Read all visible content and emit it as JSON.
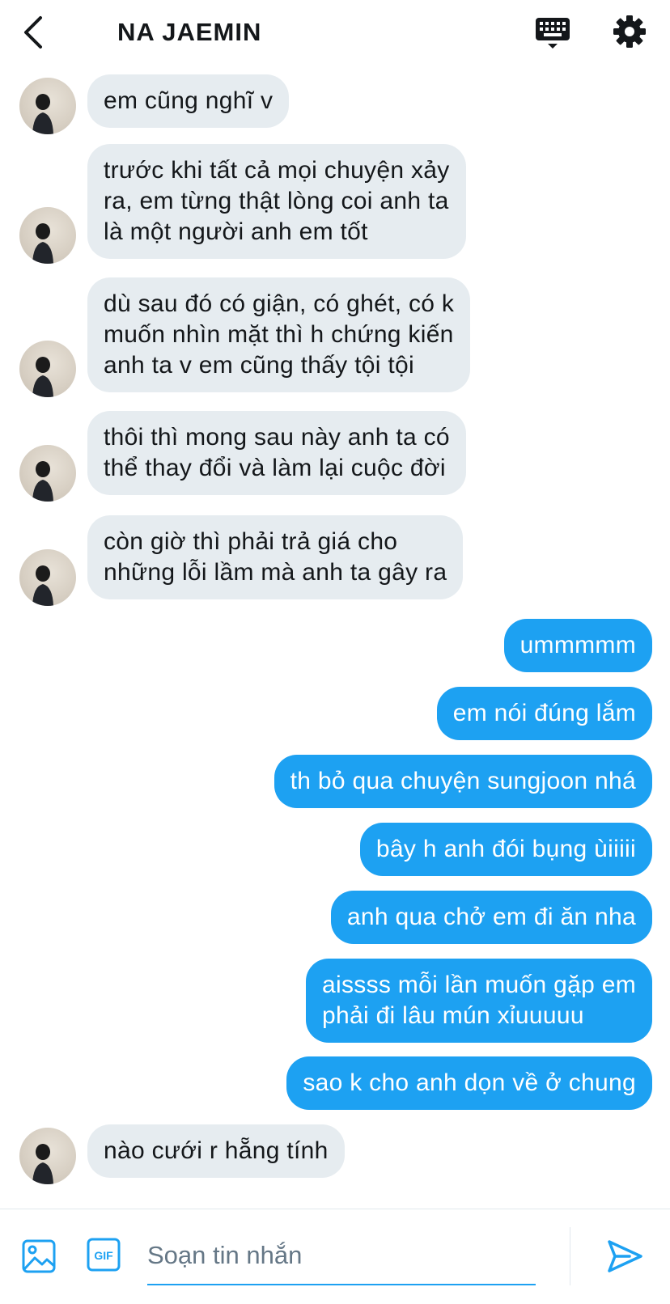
{
  "header": {
    "title": "NA JAEMIN",
    "back_icon": "chevron-left-icon",
    "keyboard_icon": "keyboard-icon",
    "settings_icon": "gear-icon"
  },
  "colors": {
    "accent": "#1da1f2",
    "incoming_bubble": "#e6ecf0",
    "text": "#14171a",
    "placeholder": "#657786"
  },
  "messages": [
    {
      "dir": "in",
      "text": "em cũng nghĩ v"
    },
    {
      "dir": "in",
      "text": "trước khi tất cả mọi chuyện xảy\nra, em từng thật lòng coi anh ta\nlà một người anh em tốt"
    },
    {
      "dir": "in",
      "text": "dù sau đó có giận, có ghét, có k\nmuốn nhìn mặt thì h chứng kiến\nanh ta v em cũng thấy tội tội"
    },
    {
      "dir": "in",
      "text": "thôi thì mong sau này anh ta có\nthể thay đổi và làm lại cuộc đời"
    },
    {
      "dir": "in",
      "text": "còn giờ thì phải trả giá cho\nnhững lỗi lầm mà anh ta gây ra"
    },
    {
      "dir": "out",
      "text": "ummmmm"
    },
    {
      "dir": "out",
      "text": "em nói đúng lắm"
    },
    {
      "dir": "out",
      "text": "th bỏ qua chuyện sungjoon nhá"
    },
    {
      "dir": "out",
      "text": "bây h anh đói bụng ùiiiii"
    },
    {
      "dir": "out",
      "text": "anh qua chở em đi ăn nha"
    },
    {
      "dir": "out",
      "text": "aissss mỗi lần muốn gặp em\nphải đi lâu mún xỉuuuuu"
    },
    {
      "dir": "out",
      "text": "sao k cho anh dọn về ở chung"
    },
    {
      "dir": "in",
      "text": "nào cưới r hẵng tính"
    }
  ],
  "composer": {
    "placeholder": "Soạn tin nhắn",
    "value": "",
    "image_icon": "image-icon",
    "gif_label": "GIF",
    "send_icon": "send-icon"
  }
}
